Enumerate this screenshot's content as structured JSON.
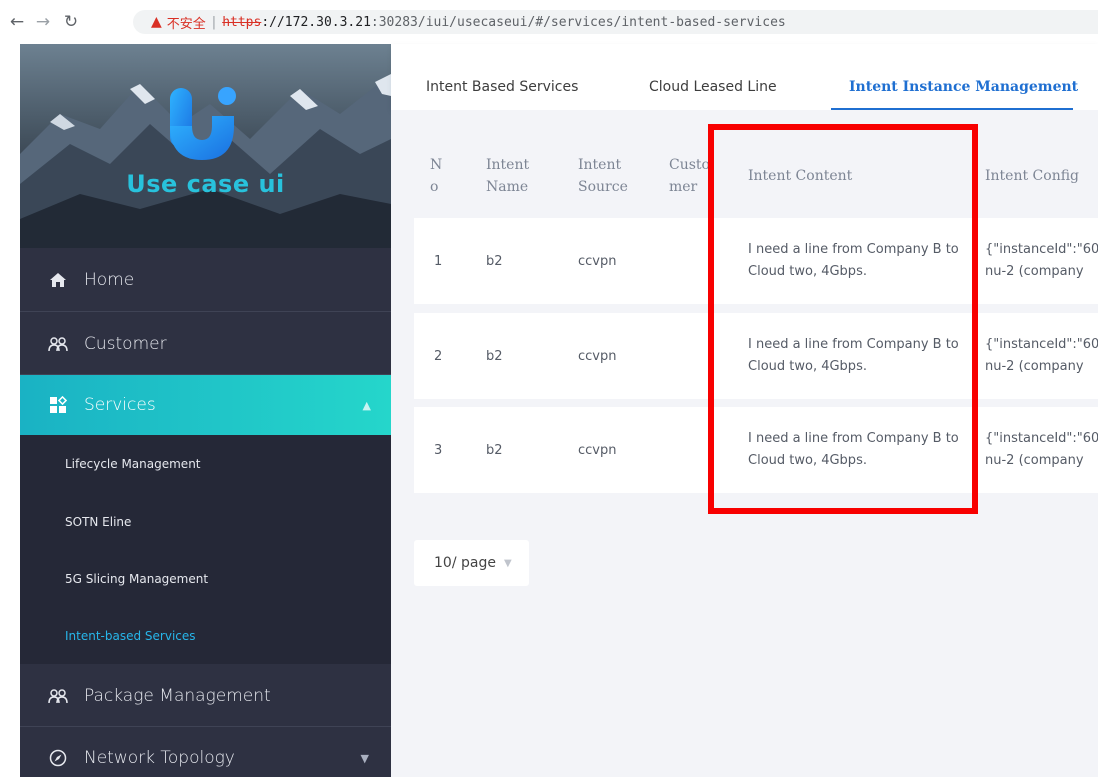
{
  "browser": {
    "insecure_label": "不安全",
    "url_scheme": "https",
    "url_host": "://172.30.3.21",
    "url_path": ":30283/iui/usecaseui/#/services/intent-based-services"
  },
  "sidebar": {
    "logo_text": "Use case ui",
    "menu": {
      "home": "Home",
      "customer": "Customer",
      "services": "Services",
      "package": "Package Management",
      "network": "Network Topology"
    },
    "submenu": {
      "lifecycle": "Lifecycle Management",
      "sotn": "SOTN Eline",
      "slicing": "5G Slicing Management",
      "intent": "Intent-based Services"
    }
  },
  "tabs": {
    "tab1": "Intent Based Services",
    "tab2": "Cloud Leased Line",
    "tab3": "Intent Instance Management"
  },
  "table": {
    "headers": {
      "no_1": "N",
      "no_2": "o",
      "name_1": "Intent",
      "name_2": "Name",
      "source_1": "Intent",
      "source_2": "Source",
      "customer_1": "Custo",
      "customer_2": "mer",
      "content": "Intent Content",
      "config": "Intent Config"
    },
    "rows": [
      {
        "no": "1",
        "name": "b2",
        "source": "ccvpn",
        "content": "I need a line from Company B to Cloud two, 4Gbps.",
        "config_1": "{\"instanceId\":\"60",
        "config_2": "nu-2 (company"
      },
      {
        "no": "2",
        "name": "b2",
        "source": "ccvpn",
        "content": "I need a line from Company B to Cloud two, 4Gbps.",
        "config_1": "{\"instanceId\":\"60",
        "config_2": "nu-2 (company"
      },
      {
        "no": "3",
        "name": "b2",
        "source": "ccvpn",
        "content": "I need a line from Company B to Cloud two, 4Gbps.",
        "config_1": "{\"instanceId\":\"60",
        "config_2": "nu-2 (company"
      }
    ]
  },
  "pager": {
    "page_size": "10/ page"
  },
  "colors": {
    "accent": "#1f6fd1",
    "sidebar_bg": "#2e3142",
    "active_menu": "#1ab2c4",
    "highlight": "#f80000"
  }
}
